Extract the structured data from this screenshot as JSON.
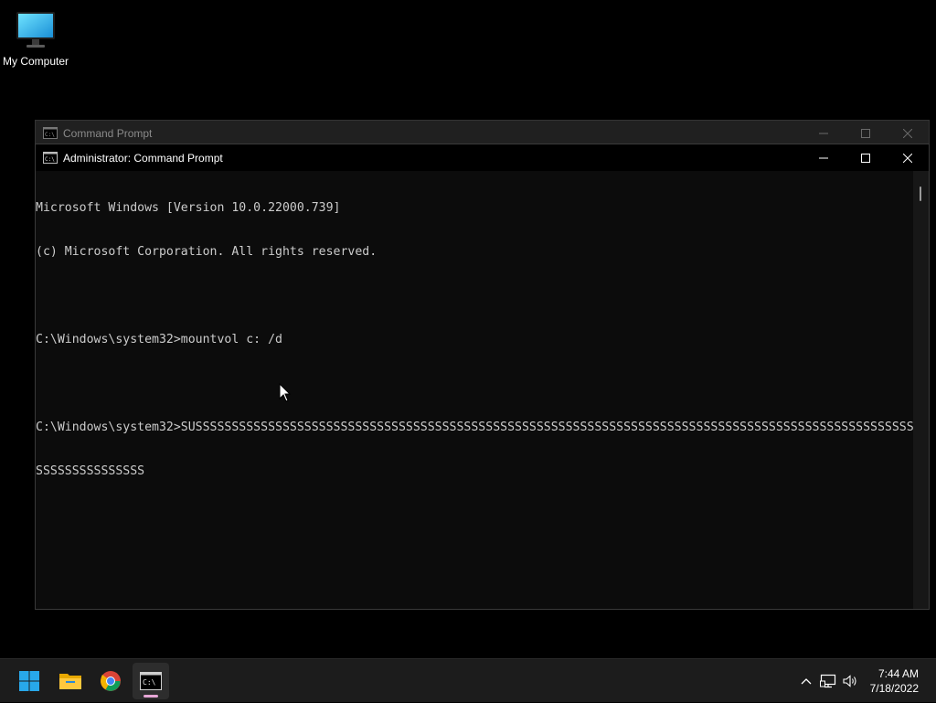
{
  "desktop": {
    "icons": [
      {
        "label": "My Computer",
        "icon": "monitor-icon"
      }
    ]
  },
  "windows": {
    "background": {
      "title": "Command Prompt",
      "icon": "cmd-icon",
      "state": "inactive"
    },
    "foreground": {
      "title": "Administrator: Command Prompt",
      "icon": "cmd-icon",
      "state": "active",
      "console_lines": [
        "Microsoft Windows [Version 10.0.22000.739]",
        "(c) Microsoft Corporation. All rights reserved.",
        "",
        "C:\\Windows\\system32>mountvol c: /d",
        "",
        "C:\\Windows\\system32>SUSSSSSSSSSSSSSSSSSSSSSSSSSSSSSSSSSSSSSSSSSSSSSSSSSSSSSSSSSSSSSSSSSSSSSSSSSSSSSSSSSSSSSSSSSSSSSSSSSSSSS",
        "SSSSSSSSSSSSSSS"
      ]
    }
  },
  "taskbar": {
    "apps": [
      {
        "name": "Start",
        "icon": "windows-start-icon",
        "active": false
      },
      {
        "name": "File Explorer",
        "icon": "folder-icon",
        "active": false
      },
      {
        "name": "Google Chrome",
        "icon": "chrome-icon",
        "active": false
      },
      {
        "name": "Command Prompt",
        "icon": "cmd-icon",
        "active": true
      }
    ],
    "tray": {
      "icons": [
        "chevron-up-icon",
        "network-icon",
        "volume-icon"
      ],
      "time": "7:44 AM",
      "date": "7/18/2022"
    }
  },
  "colors": {
    "desktop_bg": "#000000",
    "console_bg": "#0c0c0c",
    "console_text": "#cccccc",
    "taskbar_bg": "#1c1c1c",
    "active_indicator": "#e6a6d6"
  }
}
